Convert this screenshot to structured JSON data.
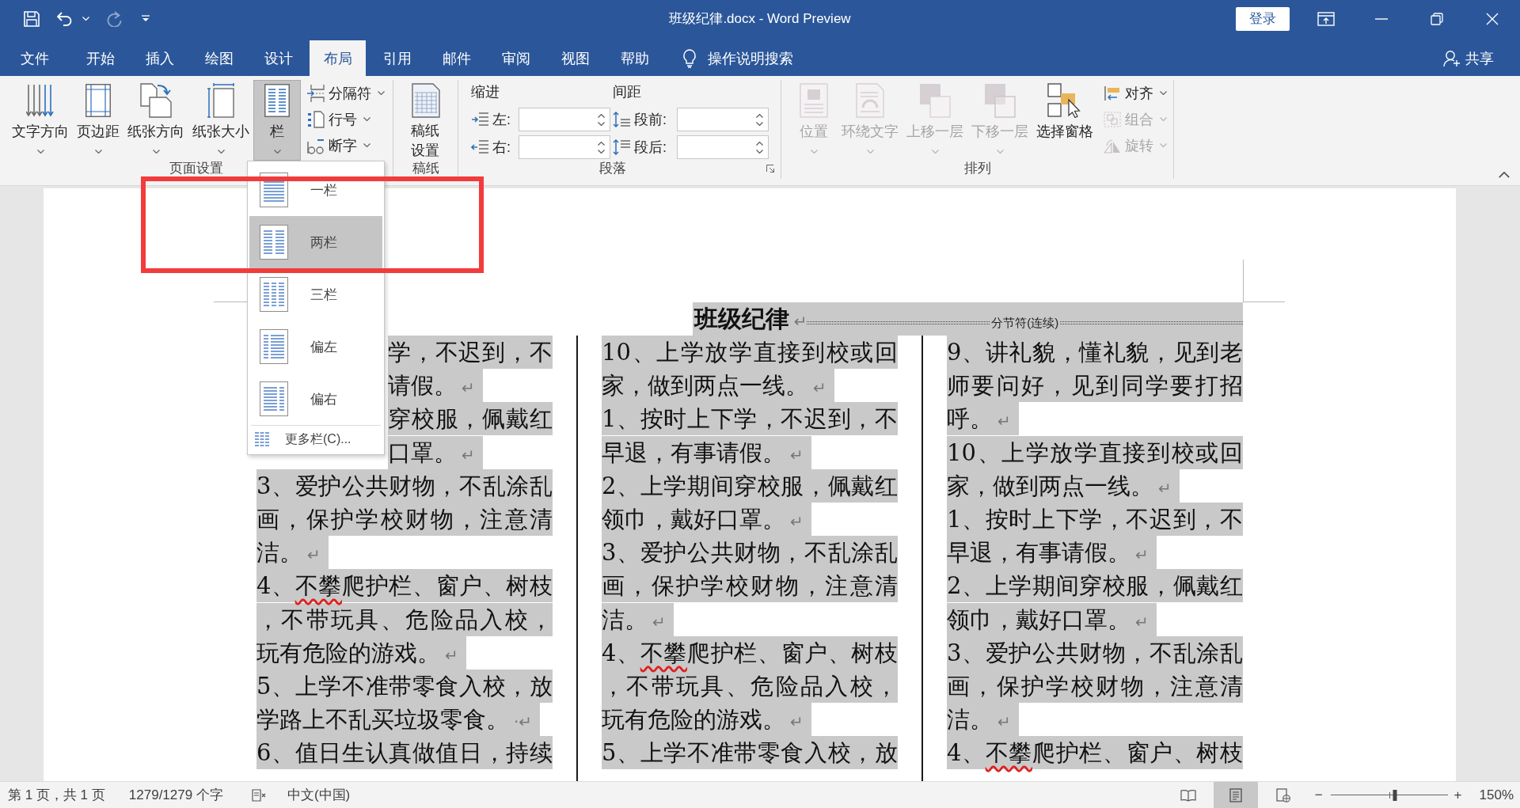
{
  "title_bar": {
    "quick_access": [
      {
        "disabled": false
      },
      {
        "disabled": false
      },
      {
        "disabled": true
      },
      {
        "disabled": false
      }
    ],
    "title": "班级纪律.docx - Word Preview",
    "sign_in": "登录"
  },
  "tabs": [
    {
      "label": "文件",
      "selected": false
    },
    {
      "label": "开始",
      "selected": false
    },
    {
      "label": "插入",
      "selected": false
    },
    {
      "label": "绘图",
      "selected": false
    },
    {
      "label": "设计",
      "selected": false
    },
    {
      "label": "布局",
      "selected": true
    },
    {
      "label": "引用",
      "selected": false
    },
    {
      "label": "邮件",
      "selected": false
    },
    {
      "label": "审阅",
      "selected": false
    },
    {
      "label": "视图",
      "selected": false
    },
    {
      "label": "帮助",
      "selected": false
    }
  ],
  "tell_me": "操作说明搜索",
  "share": "共享",
  "ribbon": {
    "page_setup": {
      "label": "页面设置",
      "large": [
        {
          "label": "文字方向",
          "pressed": false,
          "dropdown": true
        },
        {
          "label": "页边距",
          "pressed": false,
          "dropdown": true
        },
        {
          "label": "纸张方向",
          "pressed": false,
          "dropdown": true
        },
        {
          "label": "纸张大小",
          "pressed": false,
          "dropdown": true
        },
        {
          "label": "栏",
          "pressed": true,
          "dropdown": true
        }
      ],
      "small": [
        {
          "label": "分隔符"
        },
        {
          "label": "行号"
        },
        {
          "label": "断字"
        }
      ]
    },
    "manuscript": {
      "label": "稿纸",
      "button": "稿纸设置"
    },
    "paragraph": {
      "label": "段落",
      "indent": {
        "label": "缩进",
        "fields": [
          {
            "label": "左:"
          },
          {
            "label": "右:"
          }
        ]
      },
      "spacing": {
        "label": "间距",
        "fields": [
          {
            "label": "段前:"
          },
          {
            "label": "段后:"
          }
        ]
      }
    },
    "arrange": {
      "label": "排列",
      "large": [
        {
          "label": "位置",
          "disabled": true,
          "dropdown": true
        },
        {
          "label": "环绕文字",
          "disabled": true,
          "dropdown": true
        },
        {
          "label": "上移一层",
          "disabled": true,
          "dropdown": true
        },
        {
          "label": "下移一层",
          "disabled": true,
          "dropdown": true
        },
        {
          "label": "选择窗格",
          "disabled": false,
          "dropdown": false
        }
      ],
      "small": [
        {
          "label": "对齐",
          "disabled": false
        },
        {
          "label": "组合",
          "disabled": true
        },
        {
          "label": "旋转",
          "disabled": true
        }
      ]
    }
  },
  "columns_menu": {
    "items": [
      {
        "label": "一栏",
        "selected": false
      },
      {
        "label": "两栏",
        "selected": true
      },
      {
        "label": "三栏",
        "selected": false
      },
      {
        "label": "偏左",
        "selected": false
      },
      {
        "label": "偏右",
        "selected": false
      }
    ],
    "more": "更多栏(C)..."
  },
  "annotation": {
    "kind": "frame"
  },
  "document": {
    "heading": {
      "text": "班级纪律",
      "end": "↵"
    },
    "section_break": "分节符(连续)",
    "columns": [
      {
        "lines": [
          {
            "kind": "covered",
            "text": "学，不迟到，不"
          },
          {
            "kind": "covered",
            "text": "请假。",
            "end": "↵"
          },
          {
            "kind": "covered",
            "text": "穿校服，佩戴红"
          },
          {
            "kind": "covered",
            "text": "口罩。",
            "end": "↵"
          },
          {
            "kind": "plain",
            "text": "3、爱护公共财物，不乱涂乱"
          },
          {
            "kind": "plain",
            "text": "画，保护学校财物，注意清"
          },
          {
            "kind": "plain",
            "text": "洁。",
            "end": "↵"
          },
          {
            "kind": "plain",
            "parts": [
              {
                "text": "4、",
                "flagged": false
              },
              {
                "text": "不攀",
                "flagged": true
              },
              {
                "text": "爬护栏、窗户、树枝",
                "flagged": false
              }
            ]
          },
          {
            "kind": "plain",
            "text": "，不带玩具、危险品入校，"
          },
          {
            "kind": "plain",
            "text": "玩有危险的游戏。",
            "end": "↵"
          },
          {
            "kind": "plain",
            "text": "5、上学不准带零食入校，放"
          },
          {
            "kind": "plain",
            "text": "学路上不乱买垃圾零食。",
            "end": "·↵"
          },
          {
            "kind": "plain",
            "text": "6、值日生认真做值日，持续"
          }
        ]
      },
      {
        "lines": [
          {
            "kind": "plain",
            "text": "10、上学放学直接到校或回"
          },
          {
            "kind": "plain",
            "text": "家，做到两点一线。",
            "end": "↵"
          },
          {
            "kind": "plain",
            "text": "1、按时上下学，不迟到，不"
          },
          {
            "kind": "plain",
            "text": "早退，有事请假。",
            "end": "↵"
          },
          {
            "kind": "plain",
            "text": "2、上学期间穿校服，佩戴红"
          },
          {
            "kind": "plain",
            "text": "领巾，戴好口罩。",
            "end": "↵"
          },
          {
            "kind": "plain",
            "text": "3、爱护公共财物，不乱涂乱"
          },
          {
            "kind": "plain",
            "text": "画，保护学校财物，注意清"
          },
          {
            "kind": "plain",
            "text": "洁。",
            "end": "↵"
          },
          {
            "kind": "plain",
            "parts": [
              {
                "text": "4、",
                "flagged": false
              },
              {
                "text": "不攀",
                "flagged": true
              },
              {
                "text": "爬护栏、窗户、树枝",
                "flagged": false
              }
            ]
          },
          {
            "kind": "plain",
            "text": "，不带玩具、危险品入校，"
          },
          {
            "kind": "plain",
            "text": "玩有危险的游戏。",
            "end": "↵"
          },
          {
            "kind": "plain",
            "text": "5、上学不准带零食入校，放"
          }
        ]
      },
      {
        "lines": [
          {
            "kind": "plain",
            "text": "9、讲礼貌，懂礼貌，见到老"
          },
          {
            "kind": "plain",
            "text": "师要问好，见到同学要打招"
          },
          {
            "kind": "plain",
            "text": "呼。",
            "end": "↵"
          },
          {
            "kind": "plain",
            "text": "10、上学放学直接到校或回"
          },
          {
            "kind": "plain",
            "text": "家，做到两点一线。",
            "end": "↵"
          },
          {
            "kind": "plain",
            "text": "1、按时上下学，不迟到，不"
          },
          {
            "kind": "plain",
            "text": "早退，有事请假。",
            "end": "↵"
          },
          {
            "kind": "plain",
            "text": "2、上学期间穿校服，佩戴红"
          },
          {
            "kind": "plain",
            "text": "领巾，戴好口罩。",
            "end": "↵"
          },
          {
            "kind": "plain",
            "text": "3、爱护公共财物，不乱涂乱"
          },
          {
            "kind": "plain",
            "text": "画，保护学校财物，注意清"
          },
          {
            "kind": "plain",
            "text": "洁。",
            "end": "↵"
          },
          {
            "kind": "plain",
            "parts": [
              {
                "text": "4、",
                "flagged": false
              },
              {
                "text": "不攀",
                "flagged": true
              },
              {
                "text": "爬护栏、窗户、树枝",
                "flagged": false
              }
            ]
          }
        ]
      }
    ]
  },
  "status_bar": {
    "page": "第 1 页，共 1 页",
    "words": "1279/1279 个字",
    "language": "中文(中国)",
    "views": [
      {
        "selected": false
      },
      {
        "selected": true
      },
      {
        "selected": false
      }
    ],
    "zoom": {
      "minus": "−",
      "level": 0.55,
      "plus": "+",
      "reading": "150%"
    }
  }
}
